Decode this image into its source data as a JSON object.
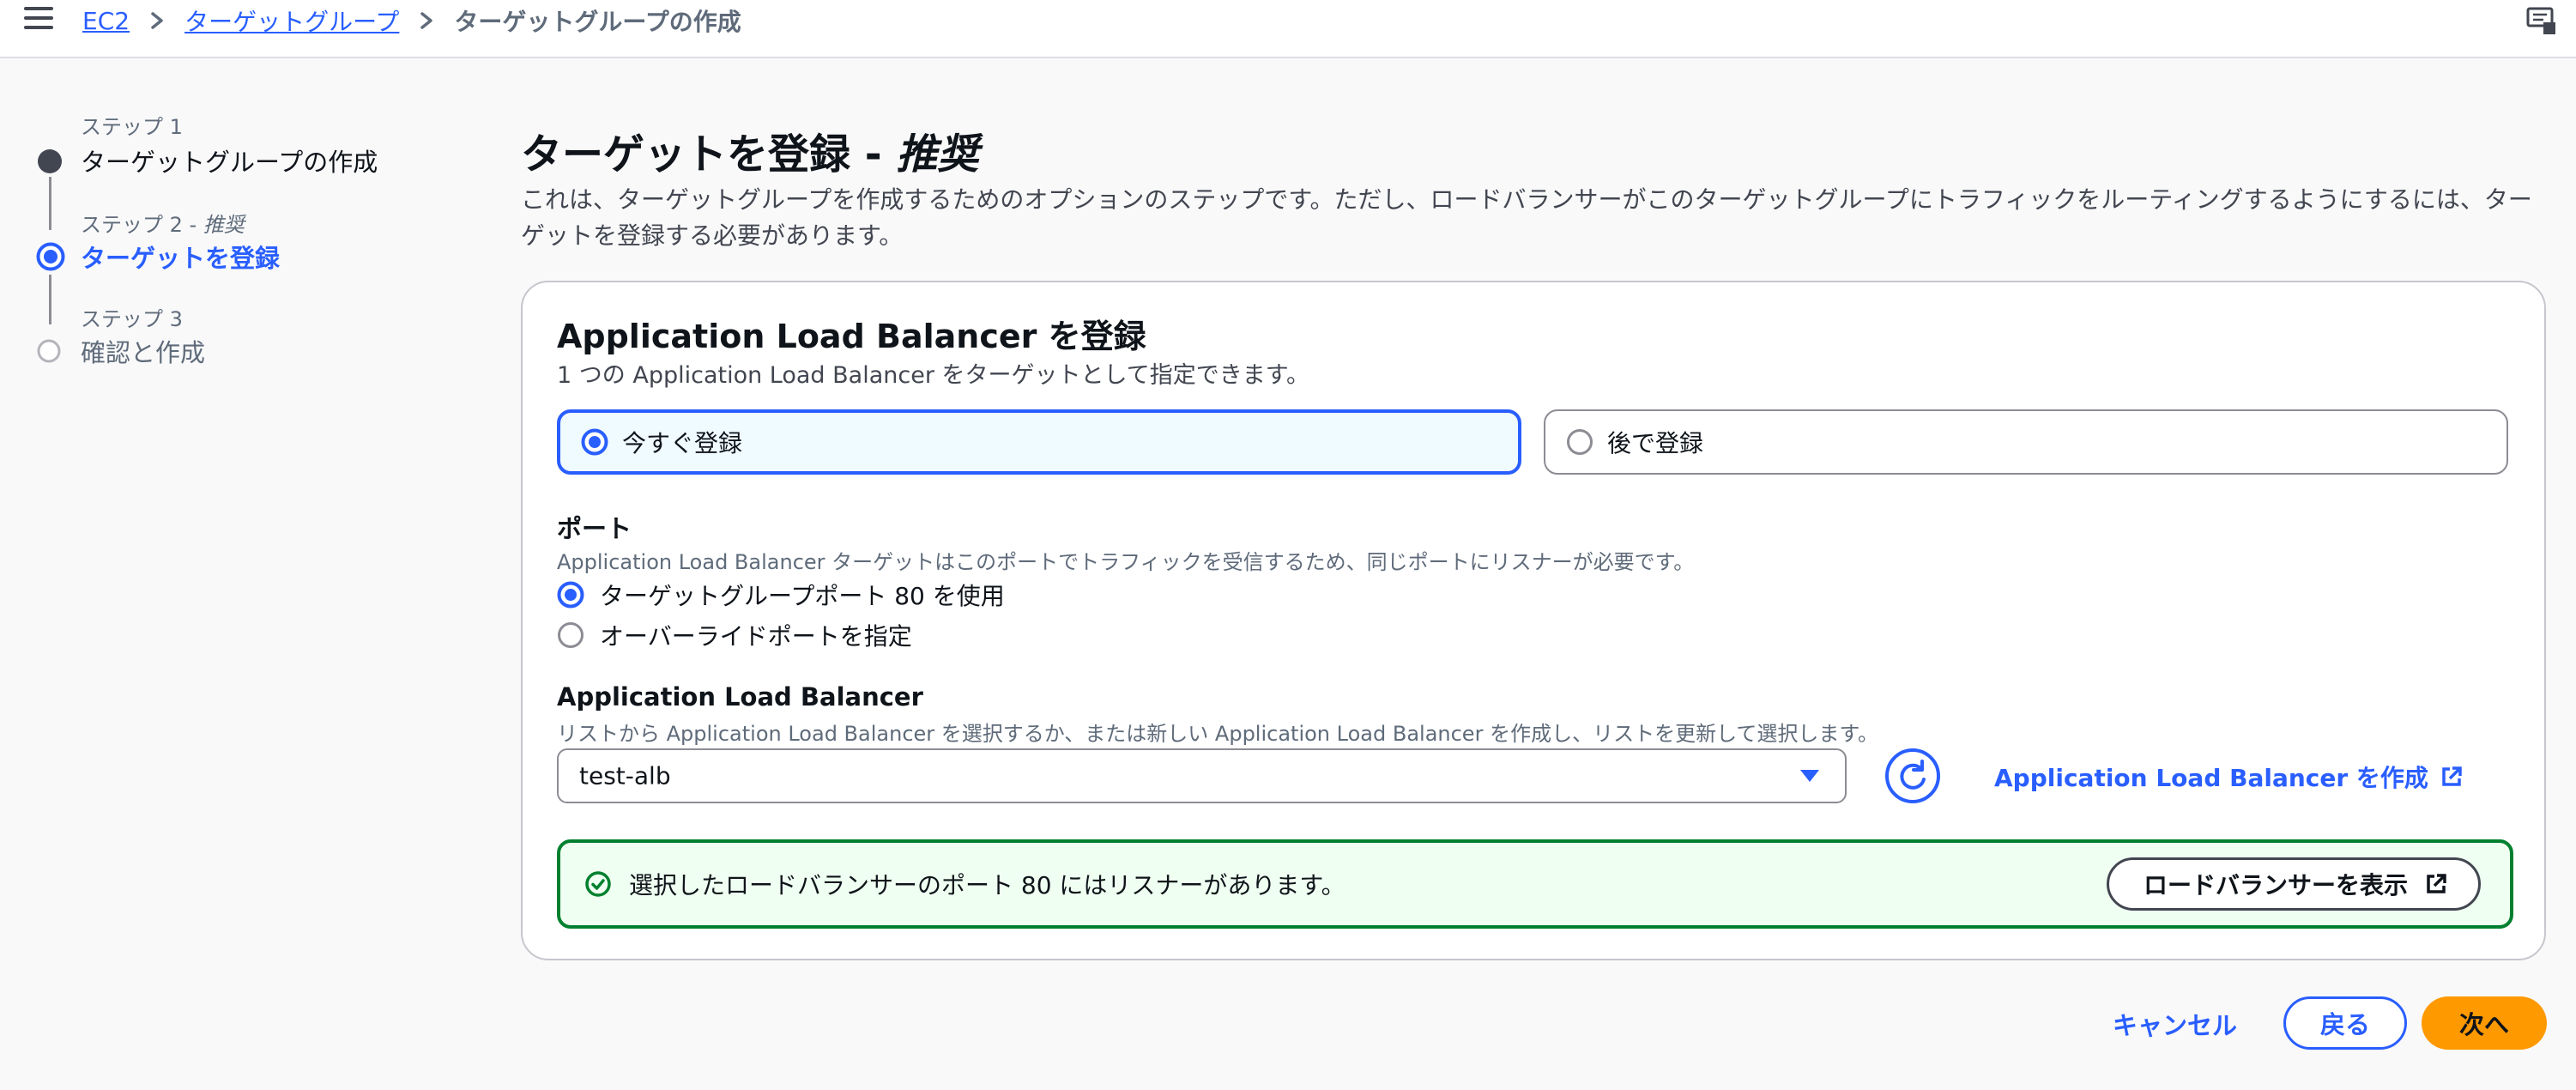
{
  "breadcrumb": {
    "items": [
      "EC2",
      "ターゲットグループ"
    ],
    "current": "ターゲットグループの作成"
  },
  "steps": [
    {
      "label": "ステップ 1",
      "title": "ターゲットグループの作成",
      "state": "completed"
    },
    {
      "label": "ステップ 2 - ",
      "label_em": "推奨",
      "title": "ターゲットを登録",
      "state": "current"
    },
    {
      "label": "ステップ 3",
      "title": "確認と作成",
      "state": "upcoming"
    }
  ],
  "page": {
    "title": "ターゲットを登録 - ",
    "title_em": "推奨",
    "description": "これは、ターゲットグループを作成するためのオプションのステップです。ただし、ロードバランサーがこのターゲットグループにトラフィックをルーティングするようにするには、ターゲットを登録する必要があります。"
  },
  "card": {
    "title": "Application Load Balancer を登録",
    "subtitle": "1 つの Application Load Balancer をターゲットとして指定できます。",
    "register_options": [
      {
        "label": "今すぐ登録",
        "selected": true
      },
      {
        "label": "後で登録",
        "selected": false
      }
    ],
    "port": {
      "label": "ポート",
      "description": "Application Load Balancer ターゲットはこのポートでトラフィックを受信するため、同じポートにリスナーが必要です。",
      "options": [
        {
          "label": "ターゲットグループポート 80 を使用",
          "selected": true
        },
        {
          "label": "オーバーライドポートを指定",
          "selected": false
        }
      ]
    },
    "alb": {
      "label": "Application Load Balancer",
      "description": "リストから Application Load Balancer を選択するか、または新しい Application Load Balancer を作成し、リストを更新して選択します。",
      "selected_value": "test-alb",
      "create_link": "Application Load Balancer を作成"
    },
    "alert": {
      "text": "選択したロードバランサーのポート 80 にはリスナーがあります。",
      "button": "ロードバランサーを表示"
    }
  },
  "footer": {
    "cancel": "キャンセル",
    "back": "戻る",
    "next": "次へ"
  },
  "colors": {
    "link_blue": "#295eff",
    "success_green": "#00802f",
    "primary_orange": "#ff9900",
    "selected_tile_bg": "#f0fbff"
  },
  "icons": [
    "menu-icon",
    "chevron-right-icon",
    "notifications-icon",
    "radio-selected-icon",
    "caret-down-icon",
    "refresh-icon",
    "external-link-icon",
    "success-icon"
  ]
}
